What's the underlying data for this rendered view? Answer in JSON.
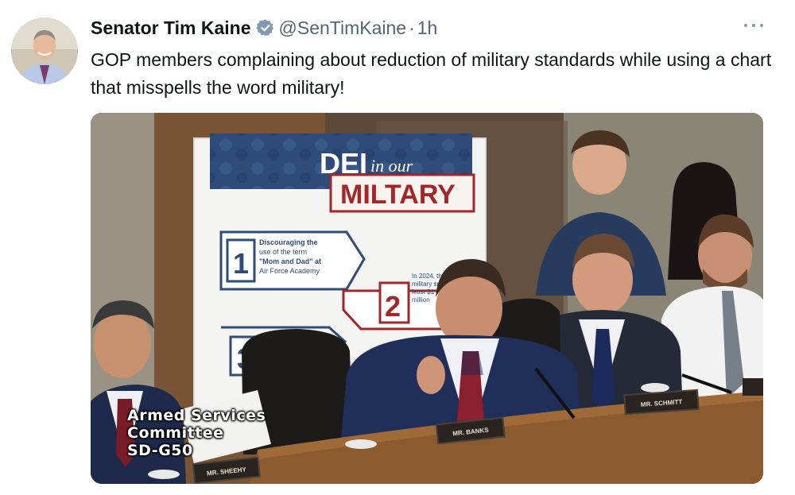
{
  "tweet": {
    "author_name": "Senator Tim Kaine",
    "handle": "@SenTimKaine",
    "separator": "·",
    "time": "1h",
    "text": "GOP members complaining about reduction of military standards while using a chart that misspells the word military!"
  },
  "media": {
    "sign": {
      "title_dei": "DEI",
      "title_in_our": "in our",
      "title_military": "MILTARY",
      "item1_number": "1",
      "item1_line1": "Discouraging the",
      "item1_line2": "use of the term",
      "item1_line3": "\"Mom and Dad\" at",
      "item1_line4": "Air Force Academy",
      "item2_number": "2",
      "item2_line1": "In 2024, the",
      "item2_line2": "military sp",
      "item2_line3": "least $1",
      "item2_line4": "million",
      "item3_number": "3"
    },
    "nameplates": {
      "banks": "MR. BANKS",
      "schmitt": "MR. SCHMITT",
      "sheehy": "MR. SHEEHY"
    },
    "caption": {
      "line1": "Armed Services",
      "line2": "Committee",
      "line3": "SD-G50"
    }
  },
  "colors": {
    "verified_badge": "#829aab",
    "sign_navy": "#2e4b7a",
    "sign_red": "#a3262a"
  },
  "icons": {
    "verified": "verified-badge-icon",
    "more": "more-options-icon"
  }
}
